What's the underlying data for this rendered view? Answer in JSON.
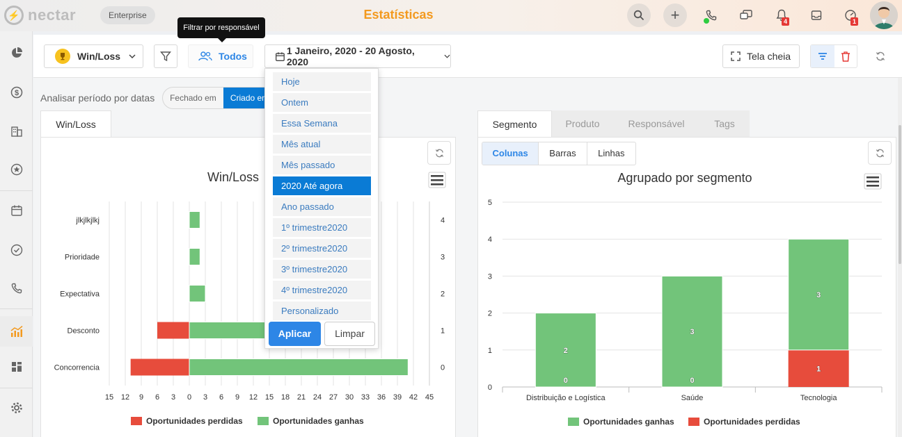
{
  "topbar": {
    "logo_text": "nectar",
    "plan": "Enterprise",
    "title": "Estatísticas",
    "notifications_count": "4",
    "tasks_count": "1",
    "brand_color": "#f39a1f"
  },
  "toolbar": {
    "report_label": "Win/Loss",
    "owner_filter_label": "Todos",
    "date_range": "1 Janeiro, 2020 - 20 Agosto, 2020",
    "fullscreen_label": "Tela cheia",
    "tooltip": "Filtrar por responsável"
  },
  "period": {
    "label": "Analisar período por datas",
    "options": [
      "Fechado em",
      "Criado em"
    ]
  },
  "date_menu": {
    "items": [
      "Hoje",
      "Ontem",
      "Essa Semana",
      "Mês atual",
      "Mês passado",
      "2020 Até agora",
      "Ano passado",
      "1º trimestre2020",
      "2º trimestre2020",
      "3º trimestre2020",
      "4º trimestre2020",
      "Personalizado"
    ],
    "selected": "2020 Até agora",
    "apply": "Aplicar",
    "clear": "Limpar"
  },
  "left_panel": {
    "tab": "Win/Loss"
  },
  "right_panel": {
    "tabs": [
      "Segmento",
      "Produto",
      "Responsável",
      "Tags"
    ],
    "view_buttons": [
      "Colunas",
      "Barras",
      "Linhas"
    ]
  },
  "chart_data": [
    {
      "type": "bar",
      "orientation": "horizontal",
      "title": "Win/Loss",
      "categories": [
        "jlkjlkjlkj",
        "Prioridade",
        "Expectativa",
        "Desconto",
        "Concorrencia"
      ],
      "right_axis_labels": [
        "4",
        "3",
        "2",
        "1",
        "0"
      ],
      "x_ticks": [
        "15",
        "12",
        "9",
        "6",
        "3",
        "0",
        "3",
        "6",
        "9",
        "12",
        "15",
        "18",
        "21",
        "24",
        "27",
        "30",
        "33",
        "36",
        "39",
        "42",
        "45"
      ],
      "xlim": [
        -15,
        45
      ],
      "series": [
        {
          "name": "Oportunidades perdidas",
          "color": "#e74c3c",
          "values": [
            0,
            0,
            0,
            6,
            11
          ]
        },
        {
          "name": "Oportunidades ganhas",
          "color": "#72c47a",
          "values": [
            2,
            2,
            3,
            16,
            41
          ]
        }
      ],
      "legend": "bottom"
    },
    {
      "type": "bar",
      "stacked": true,
      "title": "Agrupado por segmento",
      "categories": [
        "Distribuição e Logística",
        "Saúde",
        "Tecnologia"
      ],
      "y_ticks": [
        "0",
        "1",
        "2",
        "3",
        "4",
        "5"
      ],
      "ylim": [
        0,
        5
      ],
      "series": [
        {
          "name": "Oportunidades ganhas",
          "color": "#72c47a",
          "values": [
            2,
            3,
            3
          ]
        },
        {
          "name": "Oportunidades perdidas",
          "color": "#e74c3c",
          "values": [
            0,
            0,
            1
          ]
        }
      ],
      "legend": "bottom"
    }
  ]
}
